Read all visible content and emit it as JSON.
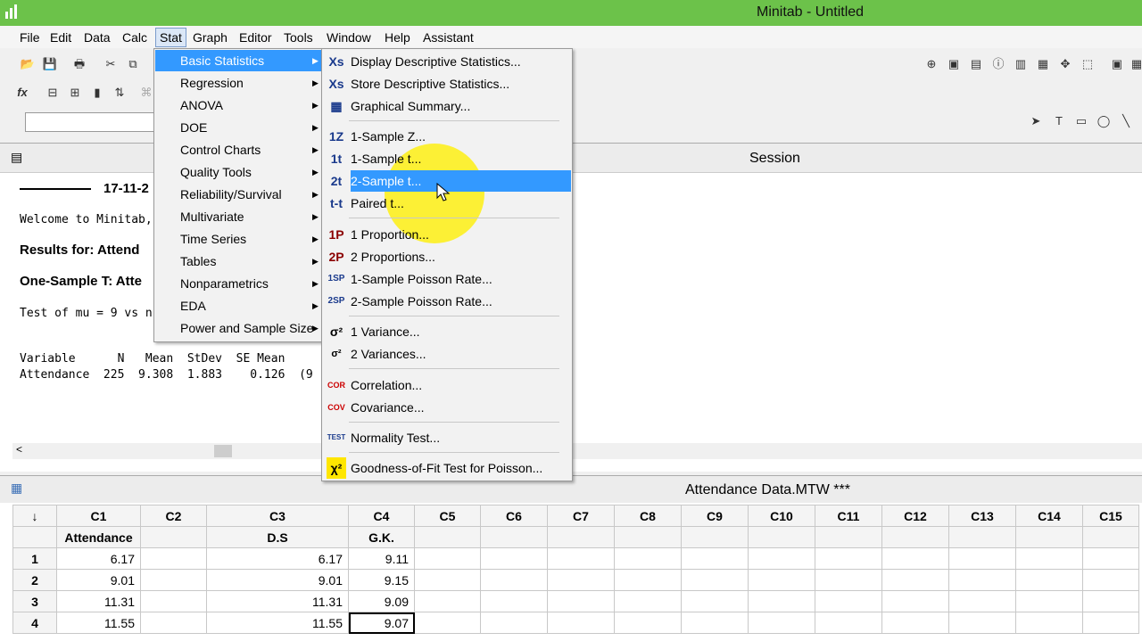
{
  "window": {
    "title": "Minitab - Untitled"
  },
  "menubar": [
    "File",
    "Edit",
    "Data",
    "Calc",
    "Stat",
    "Graph",
    "Editor",
    "Tools",
    "Window",
    "Help",
    "Assistant"
  ],
  "stat_menu": {
    "items": [
      "Basic Statistics",
      "Regression",
      "ANOVA",
      "DOE",
      "Control Charts",
      "Quality Tools",
      "Reliability/Survival",
      "Multivariate",
      "Time Series",
      "Tables",
      "Nonparametrics",
      "EDA",
      "Power and Sample Size"
    ]
  },
  "basic_stats_menu": {
    "items": [
      {
        "icon": "Xs",
        "label": "Display Descriptive Statistics..."
      },
      {
        "icon": "Xs",
        "label": "Store Descriptive Statistics..."
      },
      {
        "icon": "▦",
        "label": "Graphical Summary..."
      },
      {
        "icon": "1Z",
        "label": "1-Sample Z..."
      },
      {
        "icon": "1t",
        "label": "1-Sample t..."
      },
      {
        "icon": "2t",
        "label": "2-Sample t..."
      },
      {
        "icon": "t-t",
        "label": "Paired t..."
      },
      {
        "icon": "1P",
        "label": "1 Proportion..."
      },
      {
        "icon": "2P",
        "label": "2 Proportions..."
      },
      {
        "icon": "1SP",
        "label": "1-Sample Poisson Rate..."
      },
      {
        "icon": "2SP",
        "label": "2-Sample Poisson Rate..."
      },
      {
        "icon": "σ²",
        "label": "1 Variance..."
      },
      {
        "icon": "σ²",
        "label": "2 Variances..."
      },
      {
        "icon": "COR",
        "label": "Correlation..."
      },
      {
        "icon": "COV",
        "label": "Covariance..."
      },
      {
        "icon": "TEST",
        "label": "Normality Test..."
      },
      {
        "icon": "χ²",
        "label": "Goodness-of-Fit Test for Poisson..."
      }
    ]
  },
  "session": {
    "title": "Session",
    "date": "17-11-2",
    "welcome": "Welcome to Minitab,",
    "results": "Results for: Attend",
    "onesample": "One-Sample T: Atte",
    "test": "Test of mu = 9 vs n",
    "table_head": "Variable      N   Mean  StDev  SE Mean",
    "table_row": "Attendance  225  9.308  1.883    0.126  (9"
  },
  "worksheet": {
    "title": "Attendance Data.MTW ***",
    "columns": [
      "C1",
      "C2",
      "C3",
      "C4",
      "C5",
      "C6",
      "C7",
      "C8",
      "C9",
      "C10",
      "C11",
      "C12",
      "C13",
      "C14",
      "C15"
    ],
    "names": [
      "Attendance",
      "",
      "D.S",
      "G.K.",
      "",
      "",
      "",
      "",
      "",
      "",
      "",
      "",
      "",
      "",
      ""
    ],
    "rows": [
      {
        "n": "1",
        "c1": "6.17",
        "c3": "6.17",
        "c4": "9.11"
      },
      {
        "n": "2",
        "c1": "9.01",
        "c3": "9.01",
        "c4": "9.15"
      },
      {
        "n": "3",
        "c1": "11.31",
        "c3": "11.31",
        "c4": "9.09"
      },
      {
        "n": "4",
        "c1": "11.55",
        "c3": "11.55",
        "c4": "9.07"
      }
    ]
  }
}
